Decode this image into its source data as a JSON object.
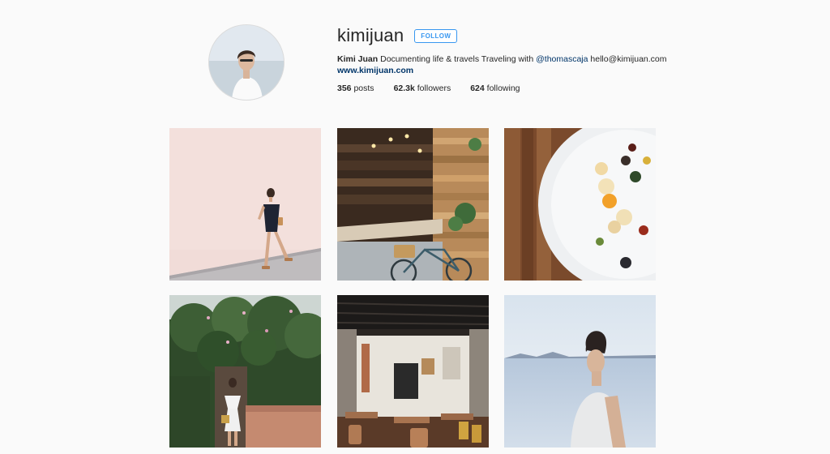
{
  "profile": {
    "username": "kimijuan",
    "follow_label": "FOLLOW",
    "full_name": "Kimi Juan",
    "bio_text": "Documenting life & travels Traveling with",
    "mention": "@thomascaja",
    "email": "hello@kimijuan.com",
    "website": "www.kimijuan.com",
    "stats": {
      "posts_count": "356",
      "posts_label": "posts",
      "followers_count": "62.3k",
      "followers_label": "followers",
      "following_count": "624",
      "following_label": "following"
    }
  },
  "posts": [
    {
      "subject": "woman-by-pink-wall"
    },
    {
      "subject": "wooden-cafe-with-bicycle"
    },
    {
      "subject": "plated-dish-on-wood-table"
    },
    {
      "subject": "woman-under-flowering-tree"
    },
    {
      "subject": "restaurant-interior"
    },
    {
      "subject": "woman-by-lake"
    }
  ],
  "colors": {
    "background": "#fafafa",
    "follow_blue": "#3897f0",
    "link_blue": "#003569"
  }
}
